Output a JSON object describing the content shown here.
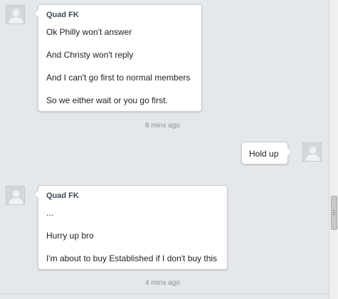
{
  "messages": [
    {
      "sender": "Quad FK",
      "lines": [
        "Ok Philly won't answer",
        "And Christy won't reply",
        "And I can't go first to normal members",
        "So we either wait or you go first."
      ],
      "time": "8 mins ago"
    },
    {
      "sender": "",
      "lines": [
        "Hold up"
      ],
      "time": ""
    },
    {
      "sender": "Quad FK",
      "lines": [
        "...",
        "Hurry up bro",
        "I'm about to buy Established if I don't buy this"
      ],
      "time": "4 mins ago"
    }
  ],
  "icons": {
    "avatar": "default-user-avatar-icon",
    "scroll_grip": "scroll-grip-icon"
  },
  "colors": {
    "background": "#e5e8eb",
    "bubble": "#ffffff",
    "sender": "#3d4a56",
    "timestamp": "#8a9096"
  }
}
